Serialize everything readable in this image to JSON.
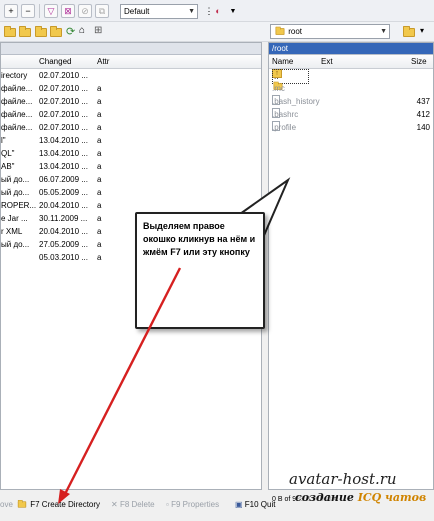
{
  "toolbar": {
    "filter_combo": "Default",
    "right_drive_combo": "root",
    "left_drive_combo": ""
  },
  "left_panel": {
    "columns": {
      "changed": "Changed",
      "attr": "Attr"
    },
    "rows": [
      {
        "name": "irectory",
        "changed": "02.07.2010 ...",
        "attr": ""
      },
      {
        "name": "файле...",
        "changed": "02.07.2010 ...",
        "attr": "a"
      },
      {
        "name": "файле...",
        "changed": "02.07.2010 ...",
        "attr": "a"
      },
      {
        "name": "файле...",
        "changed": "02.07.2010 ...",
        "attr": "a"
      },
      {
        "name": "файле...",
        "changed": "02.07.2010 ...",
        "attr": "a"
      },
      {
        "name": "l\"",
        "changed": "13.04.2010 ...",
        "attr": "a"
      },
      {
        "name": "QL\"",
        "changed": "13.04.2010 ...",
        "attr": "a"
      },
      {
        "name": "AB\"",
        "changed": "13.04.2010 ...",
        "attr": "a"
      },
      {
        "name": "ый до...",
        "changed": "06.07.2009 ...",
        "attr": "a"
      },
      {
        "name": "ый до...",
        "changed": "05.05.2009 ...",
        "attr": "a"
      },
      {
        "name": "ROPER...",
        "changed": "20.04.2010 ...",
        "attr": "a"
      },
      {
        "name": "e Jar ...",
        "changed": "30.11.2009 ...",
        "attr": "a"
      },
      {
        "name": "r XML",
        "changed": "20.04.2010 ...",
        "attr": "a"
      },
      {
        "name": "ый до...",
        "changed": "27.05.2009 ...",
        "attr": "a"
      },
      {
        "name": "",
        "changed": "05.03.2010 ...",
        "attr": "a"
      }
    ]
  },
  "right_panel": {
    "path": "/root",
    "columns": {
      "name": "Name",
      "ext": "Ext",
      "size": "Size"
    },
    "rows": [
      {
        "name": "..",
        "ext": "",
        "size": "",
        "kind": "up"
      },
      {
        "name": ".mc",
        "ext": "",
        "size": "",
        "kind": "folder"
      },
      {
        "name": ".bash_history",
        "ext": "",
        "size": "437",
        "kind": "file"
      },
      {
        "name": ".bashrc",
        "ext": "",
        "size": "412",
        "kind": "file"
      },
      {
        "name": ".profile",
        "ext": "",
        "size": "140",
        "kind": "file"
      }
    ],
    "status": "0 B of 989 B in 0 of 4"
  },
  "callout": {
    "text": "Выделяем правое окошко кликнув на нём и жмём F7 или эту кнопку"
  },
  "function_keys": [
    {
      "label": "ove",
      "disabled": true
    },
    {
      "label": "F7 Create Directory",
      "disabled": false
    },
    {
      "label": "F8 Delete",
      "disabled": true
    },
    {
      "label": "F9 Properties",
      "disabled": true
    },
    {
      "label": "F10 Quit",
      "disabled": false
    }
  ],
  "watermark": {
    "site": "avatar-host.ru",
    "tagline_pre": "создание ",
    "tagline_highlight": "ICQ чатов"
  },
  "colors": {
    "arrow": "#d62020",
    "path_active": "#3567b8"
  }
}
